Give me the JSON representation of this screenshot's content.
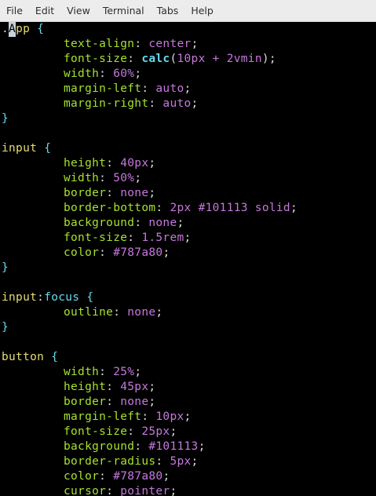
{
  "menubar": {
    "items": [
      "File",
      "Edit",
      "View",
      "Terminal",
      "Tabs",
      "Help"
    ]
  },
  "colors": {
    "background": "#000000",
    "menubar_bg": "#ececec",
    "menubar_text": "#2e2e2e",
    "selector": "#e6db74",
    "brace": "#66d9ef",
    "property": "#a6e22e",
    "value": "#c678dd",
    "punct": "#dcdcdc",
    "cursor_bg": "#c9d1d9"
  },
  "editor": {
    "cursor_line": 0,
    "cursor_char": "A",
    "lines": [
      {
        "indent": false,
        "tokens": [
          {
            "t": ".",
            "c": "punct"
          },
          {
            "t": "A",
            "c": "cursor"
          },
          {
            "t": "pp",
            "c": "selector"
          },
          {
            "t": " ",
            "c": "punct"
          },
          {
            "t": "{",
            "c": "brace"
          }
        ]
      },
      {
        "indent": true,
        "tokens": [
          {
            "t": "text-align",
            "c": "property"
          },
          {
            "t": ": ",
            "c": "punct"
          },
          {
            "t": "center",
            "c": "value"
          },
          {
            "t": ";",
            "c": "punct"
          }
        ]
      },
      {
        "indent": true,
        "tokens": [
          {
            "t": "font-size",
            "c": "property"
          },
          {
            "t": ": ",
            "c": "punct"
          },
          {
            "t": "calc",
            "c": "brace",
            "b": true
          },
          {
            "t": "(",
            "c": "punct"
          },
          {
            "t": "10px + 2vmin",
            "c": "value"
          },
          {
            "t": ");",
            "c": "punct"
          }
        ]
      },
      {
        "indent": true,
        "tokens": [
          {
            "t": "width",
            "c": "property"
          },
          {
            "t": ": ",
            "c": "punct"
          },
          {
            "t": "60%",
            "c": "value"
          },
          {
            "t": ";",
            "c": "punct"
          }
        ]
      },
      {
        "indent": true,
        "tokens": [
          {
            "t": "margin-left",
            "c": "property"
          },
          {
            "t": ": ",
            "c": "punct"
          },
          {
            "t": "auto",
            "c": "value"
          },
          {
            "t": ";",
            "c": "punct"
          }
        ]
      },
      {
        "indent": true,
        "tokens": [
          {
            "t": "margin-right",
            "c": "property"
          },
          {
            "t": ": ",
            "c": "punct"
          },
          {
            "t": "auto",
            "c": "value"
          },
          {
            "t": ";",
            "c": "punct"
          }
        ]
      },
      {
        "indent": false,
        "tokens": [
          {
            "t": "}",
            "c": "brace"
          }
        ]
      },
      {
        "indent": false,
        "tokens": []
      },
      {
        "indent": false,
        "tokens": [
          {
            "t": "input",
            "c": "selector"
          },
          {
            "t": " ",
            "c": "punct"
          },
          {
            "t": "{",
            "c": "brace"
          }
        ]
      },
      {
        "indent": true,
        "tokens": [
          {
            "t": "height",
            "c": "property"
          },
          {
            "t": ": ",
            "c": "punct"
          },
          {
            "t": "40px",
            "c": "value"
          },
          {
            "t": ";",
            "c": "punct"
          }
        ]
      },
      {
        "indent": true,
        "tokens": [
          {
            "t": "width",
            "c": "property"
          },
          {
            "t": ": ",
            "c": "punct"
          },
          {
            "t": "50%",
            "c": "value"
          },
          {
            "t": ";",
            "c": "punct"
          }
        ]
      },
      {
        "indent": true,
        "tokens": [
          {
            "t": "border",
            "c": "property"
          },
          {
            "t": ": ",
            "c": "punct"
          },
          {
            "t": "none",
            "c": "value"
          },
          {
            "t": ";",
            "c": "punct"
          }
        ]
      },
      {
        "indent": true,
        "tokens": [
          {
            "t": "border-bottom",
            "c": "property"
          },
          {
            "t": ": ",
            "c": "punct"
          },
          {
            "t": "2px #101113 solid",
            "c": "value"
          },
          {
            "t": ";",
            "c": "punct"
          }
        ]
      },
      {
        "indent": true,
        "tokens": [
          {
            "t": "background",
            "c": "property"
          },
          {
            "t": ": ",
            "c": "punct"
          },
          {
            "t": "none",
            "c": "value"
          },
          {
            "t": ";",
            "c": "punct"
          }
        ]
      },
      {
        "indent": true,
        "tokens": [
          {
            "t": "font-size",
            "c": "property"
          },
          {
            "t": ": ",
            "c": "punct"
          },
          {
            "t": "1.5rem",
            "c": "value"
          },
          {
            "t": ";",
            "c": "punct"
          }
        ]
      },
      {
        "indent": true,
        "tokens": [
          {
            "t": "color",
            "c": "property"
          },
          {
            "t": ": ",
            "c": "punct"
          },
          {
            "t": "#787a80",
            "c": "value"
          },
          {
            "t": ";",
            "c": "punct"
          }
        ]
      },
      {
        "indent": false,
        "tokens": [
          {
            "t": "}",
            "c": "brace"
          }
        ]
      },
      {
        "indent": false,
        "tokens": []
      },
      {
        "indent": false,
        "tokens": [
          {
            "t": "input",
            "c": "selector"
          },
          {
            "t": ":",
            "c": "punct"
          },
          {
            "t": "focus",
            "c": "brace"
          },
          {
            "t": " ",
            "c": "punct"
          },
          {
            "t": "{",
            "c": "brace"
          }
        ]
      },
      {
        "indent": true,
        "tokens": [
          {
            "t": "outline",
            "c": "property"
          },
          {
            "t": ": ",
            "c": "punct"
          },
          {
            "t": "none",
            "c": "value"
          },
          {
            "t": ";",
            "c": "punct"
          }
        ]
      },
      {
        "indent": false,
        "tokens": [
          {
            "t": "}",
            "c": "brace"
          }
        ]
      },
      {
        "indent": false,
        "tokens": []
      },
      {
        "indent": false,
        "tokens": [
          {
            "t": "button",
            "c": "selector"
          },
          {
            "t": " ",
            "c": "punct"
          },
          {
            "t": "{",
            "c": "brace"
          }
        ]
      },
      {
        "indent": true,
        "tokens": [
          {
            "t": "width",
            "c": "property"
          },
          {
            "t": ": ",
            "c": "punct"
          },
          {
            "t": "25%",
            "c": "value"
          },
          {
            "t": ";",
            "c": "punct"
          }
        ]
      },
      {
        "indent": true,
        "tokens": [
          {
            "t": "height",
            "c": "property"
          },
          {
            "t": ": ",
            "c": "punct"
          },
          {
            "t": "45px",
            "c": "value"
          },
          {
            "t": ";",
            "c": "punct"
          }
        ]
      },
      {
        "indent": true,
        "tokens": [
          {
            "t": "border",
            "c": "property"
          },
          {
            "t": ": ",
            "c": "punct"
          },
          {
            "t": "none",
            "c": "value"
          },
          {
            "t": ";",
            "c": "punct"
          }
        ]
      },
      {
        "indent": true,
        "tokens": [
          {
            "t": "margin-left",
            "c": "property"
          },
          {
            "t": ": ",
            "c": "punct"
          },
          {
            "t": "10px",
            "c": "value"
          },
          {
            "t": ";",
            "c": "punct"
          }
        ]
      },
      {
        "indent": true,
        "tokens": [
          {
            "t": "font-size",
            "c": "property"
          },
          {
            "t": ": ",
            "c": "punct"
          },
          {
            "t": "25px",
            "c": "value"
          },
          {
            "t": ";",
            "c": "punct"
          }
        ]
      },
      {
        "indent": true,
        "tokens": [
          {
            "t": "background",
            "c": "property"
          },
          {
            "t": ": ",
            "c": "punct"
          },
          {
            "t": "#101113",
            "c": "value"
          },
          {
            "t": ";",
            "c": "punct"
          }
        ]
      },
      {
        "indent": true,
        "tokens": [
          {
            "t": "border-radius",
            "c": "property"
          },
          {
            "t": ": ",
            "c": "punct"
          },
          {
            "t": "5px",
            "c": "value"
          },
          {
            "t": ";",
            "c": "punct"
          }
        ]
      },
      {
        "indent": true,
        "tokens": [
          {
            "t": "color",
            "c": "property"
          },
          {
            "t": ": ",
            "c": "punct"
          },
          {
            "t": "#787a80",
            "c": "value"
          },
          {
            "t": ";",
            "c": "punct"
          }
        ]
      },
      {
        "indent": true,
        "tokens": [
          {
            "t": "cursor",
            "c": "property"
          },
          {
            "t": ": ",
            "c": "punct"
          },
          {
            "t": "pointer",
            "c": "value"
          },
          {
            "t": ";",
            "c": "punct"
          }
        ]
      }
    ]
  }
}
